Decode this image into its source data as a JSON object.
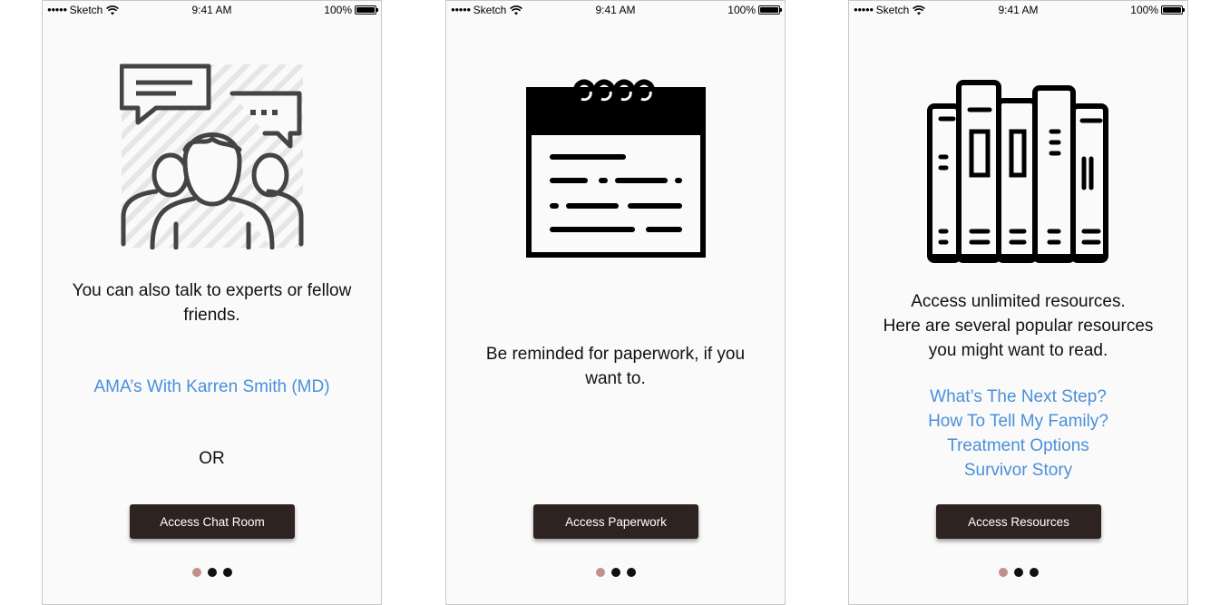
{
  "status_bar": {
    "carrier": "Sketch",
    "time": "9:41 AM",
    "battery": "100%"
  },
  "colors": {
    "button_bg": "#2f2322",
    "link": "#4a90d9",
    "active_dot": "#c28f8a"
  },
  "screens": [
    {
      "icon": "people-chat-icon",
      "description": "You can also talk to experts or fellow\nfriends.",
      "link": "AMA’s With Karren Smith (MD)",
      "or_text": "OR",
      "button": "Access Chat Room",
      "pager": {
        "pages": 3,
        "current": 1
      }
    },
    {
      "icon": "calendar-icon",
      "description": "Be reminded for paperwork, if you\nwant to.",
      "button": "Access Paperwork",
      "pager": {
        "pages": 3,
        "current": 1
      }
    },
    {
      "icon": "books-icon",
      "description": "Access unlimited resources.\nHere are several popular resources\nyou might want to read.",
      "links": [
        "What’s The Next Step?",
        "How To Tell My Family?",
        "Treatment Options",
        "Survivor Story"
      ],
      "button": "Access Resources",
      "pager": {
        "pages": 3,
        "current": 1
      }
    }
  ]
}
